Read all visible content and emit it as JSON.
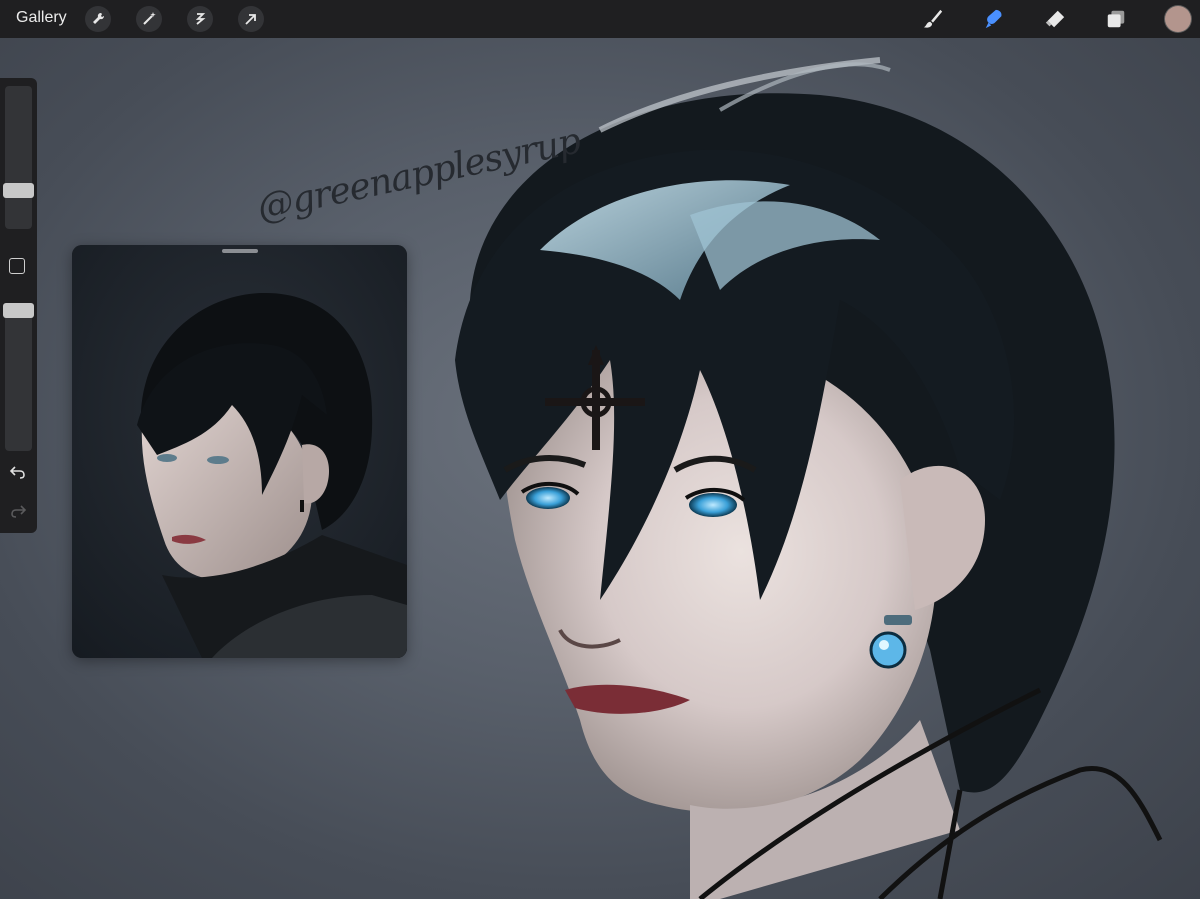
{
  "topbar": {
    "gallery_label": "Gallery",
    "left_tools": [
      "wrench-icon",
      "magic-wand-icon",
      "selection-icon",
      "transform-arrow-icon"
    ],
    "right_tools": [
      "brush-icon",
      "smudge-icon",
      "eraser-icon",
      "layers-icon"
    ],
    "active_tool": "smudge-icon",
    "active_color": "#4a90ff",
    "current_color": "#b3958d"
  },
  "sidebar": {
    "brush_size_level": 0.75,
    "opacity_level": 0.05,
    "icons": [
      "modify-square-icon",
      "undo-icon",
      "redo-icon"
    ]
  },
  "canvas": {
    "signature": "@greenapplesyrup"
  }
}
